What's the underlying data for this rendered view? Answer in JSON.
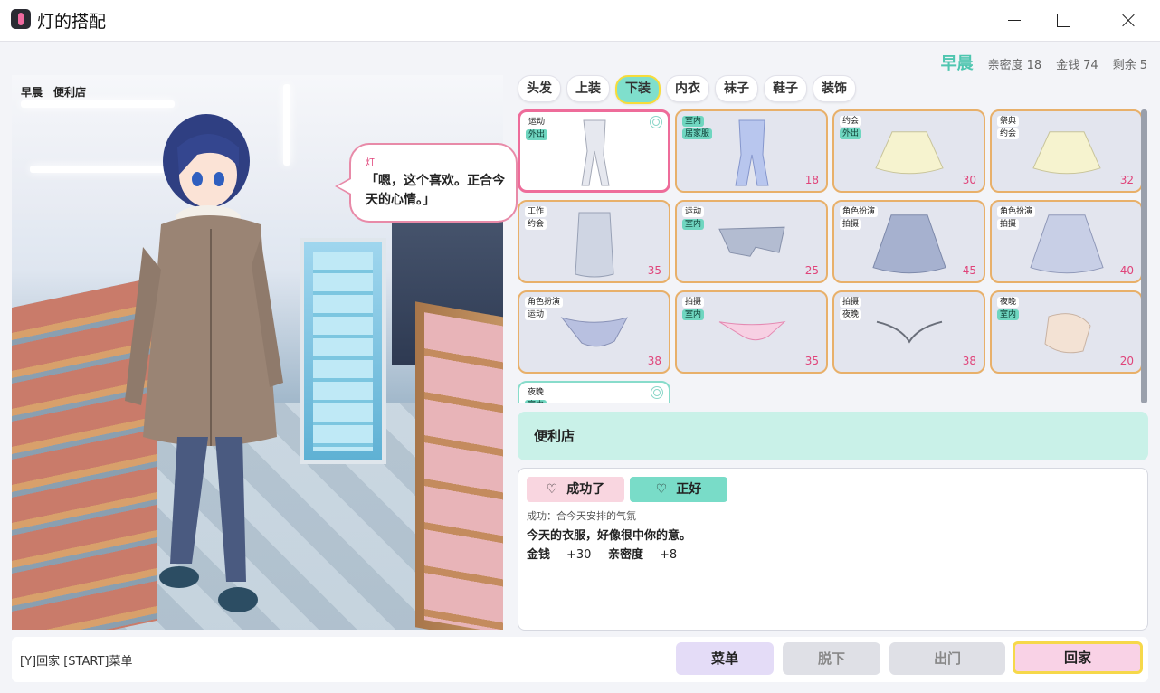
{
  "window": {
    "title": "灯的搭配",
    "icon": "app-icon"
  },
  "status": {
    "time": "早晨",
    "affinity_label": "亲密度",
    "affinity": "18",
    "money_label": "金钱",
    "money": "74",
    "remaining_label": "剩余",
    "remaining": "5"
  },
  "scene": {
    "time": "早晨",
    "place": "便利店"
  },
  "speech": {
    "speaker": "灯",
    "text": "「嗯，这个喜欢。正合今天的心情。」"
  },
  "tabs": [
    {
      "label": "头发",
      "active": false
    },
    {
      "label": "上装",
      "active": false
    },
    {
      "label": "下装",
      "active": true
    },
    {
      "label": "内衣",
      "active": false
    },
    {
      "label": "袜子",
      "active": false
    },
    {
      "label": "鞋子",
      "active": false
    },
    {
      "label": "装饰",
      "active": false
    }
  ],
  "items": [
    {
      "tags": [
        "运动",
        "外出"
      ],
      "green": [
        false,
        true
      ],
      "price": "",
      "selected": true,
      "owned": true,
      "icon": "leggings-icon"
    },
    {
      "tags": [
        "室内",
        "居家服"
      ],
      "green": [
        true,
        true
      ],
      "price": "18",
      "icon": "pajama-pants-icon"
    },
    {
      "tags": [
        "约会",
        "外出"
      ],
      "green": [
        false,
        true
      ],
      "price": "30",
      "icon": "skirt-icon"
    },
    {
      "tags": [
        "祭典",
        "约会"
      ],
      "green": [
        false,
        false
      ],
      "price": "32",
      "icon": "skirt-icon"
    },
    {
      "tags": [
        "工作",
        "约会"
      ],
      "green": [
        false,
        false
      ],
      "price": "35",
      "icon": "pencil-skirt-icon"
    },
    {
      "tags": [
        "运动",
        "室内"
      ],
      "green": [
        false,
        true
      ],
      "price": "25",
      "icon": "shorts-icon"
    },
    {
      "tags": [
        "角色扮演",
        "拍摄"
      ],
      "green": [
        false,
        false
      ],
      "price": "45",
      "icon": "pleated-skirt-icon"
    },
    {
      "tags": [
        "角色扮演",
        "拍摄"
      ],
      "green": [
        false,
        false
      ],
      "price": "40",
      "icon": "plaid-skirt-icon"
    },
    {
      "tags": [
        "角色扮演",
        "运动"
      ],
      "green": [
        false,
        false
      ],
      "price": "38",
      "icon": "briefs-icon"
    },
    {
      "tags": [
        "拍摄",
        "室内"
      ],
      "green": [
        false,
        true
      ],
      "price": "35",
      "icon": "bikini-bottom-icon"
    },
    {
      "tags": [
        "拍摄",
        "夜晚"
      ],
      "green": [
        false,
        false
      ],
      "price": "38",
      "icon": "string-bottom-icon"
    },
    {
      "tags": [
        "夜晚",
        "室内"
      ],
      "green": [
        false,
        true
      ],
      "price": "20",
      "icon": "underwear-icon"
    },
    {
      "tags": [
        "夜晚",
        "室内"
      ],
      "green": [
        false,
        true
      ],
      "price": "",
      "owned": true,
      "teal": true,
      "icon": "item-icon"
    }
  ],
  "description": {
    "text": "便利店"
  },
  "result": {
    "badge1": "成功了",
    "badge2": "正好",
    "reason": "成功：合今天安排的气氛",
    "line": "今天的衣服，好像很中你的意。",
    "money_label": "金钱",
    "money_delta": "+30",
    "affinity_label": "亲密度",
    "affinity_delta": "+8"
  },
  "footer": {
    "hint": "[Y]回家 [START]菜单",
    "menu": "菜单",
    "undress": "脱下",
    "go_out": "出门",
    "go_home": "回家"
  },
  "colors": {
    "accent_teal": "#7fdfcc",
    "accent_pink": "#e0447a",
    "card_border": "#e8b06a",
    "active_tab_ring": "#f7dc3a"
  }
}
